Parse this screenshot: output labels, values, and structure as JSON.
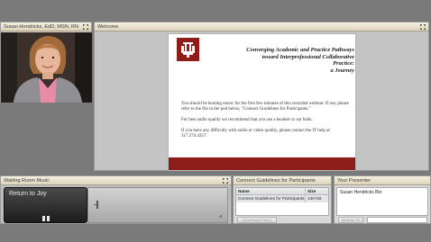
{
  "pods": {
    "presenter": {
      "title": "Susan Hendricks, EdD, MSN, RN"
    },
    "welcome": {
      "title": "Welcome",
      "document": {
        "logo": "IU",
        "title_lines": [
          "Converging Academic and Practice Pathways",
          "toward Interprofessional Collaborative",
          "Practice:",
          "a Journey"
        ],
        "paragraphs": [
          "You should be hearing music for the first few minutes of this recorded webinar. If not, please refer to the file in the pod below, \"Connect Guidelines for Participants.\"",
          "For best audio quality we recommend that you use a headset or ear buds.",
          "If you have any difficulty with audio or video quality, please contact the IT help at 317.274.4357."
        ],
        "accent_color": "#8c1d18"
      }
    },
    "music": {
      "title": "Waiting Room Music",
      "track_title": "Return to Joy"
    },
    "guidelines": {
      "title": "Connect Guidelines for Participants",
      "columns": [
        "Name",
        "Size"
      ],
      "rows": [
        {
          "name": "Connect Guidelines for Participants.pdf",
          "size": "140 KB"
        }
      ],
      "download_label": "Download File(s)"
    },
    "your_presenter": {
      "title": "Your Presenter",
      "bio_item": "Susan Hendricks Bio",
      "browse_label": "Browse To"
    }
  },
  "icons": {
    "maximize": "maximize-icon",
    "pause": "pause-icon",
    "volume": "volume-icon"
  }
}
